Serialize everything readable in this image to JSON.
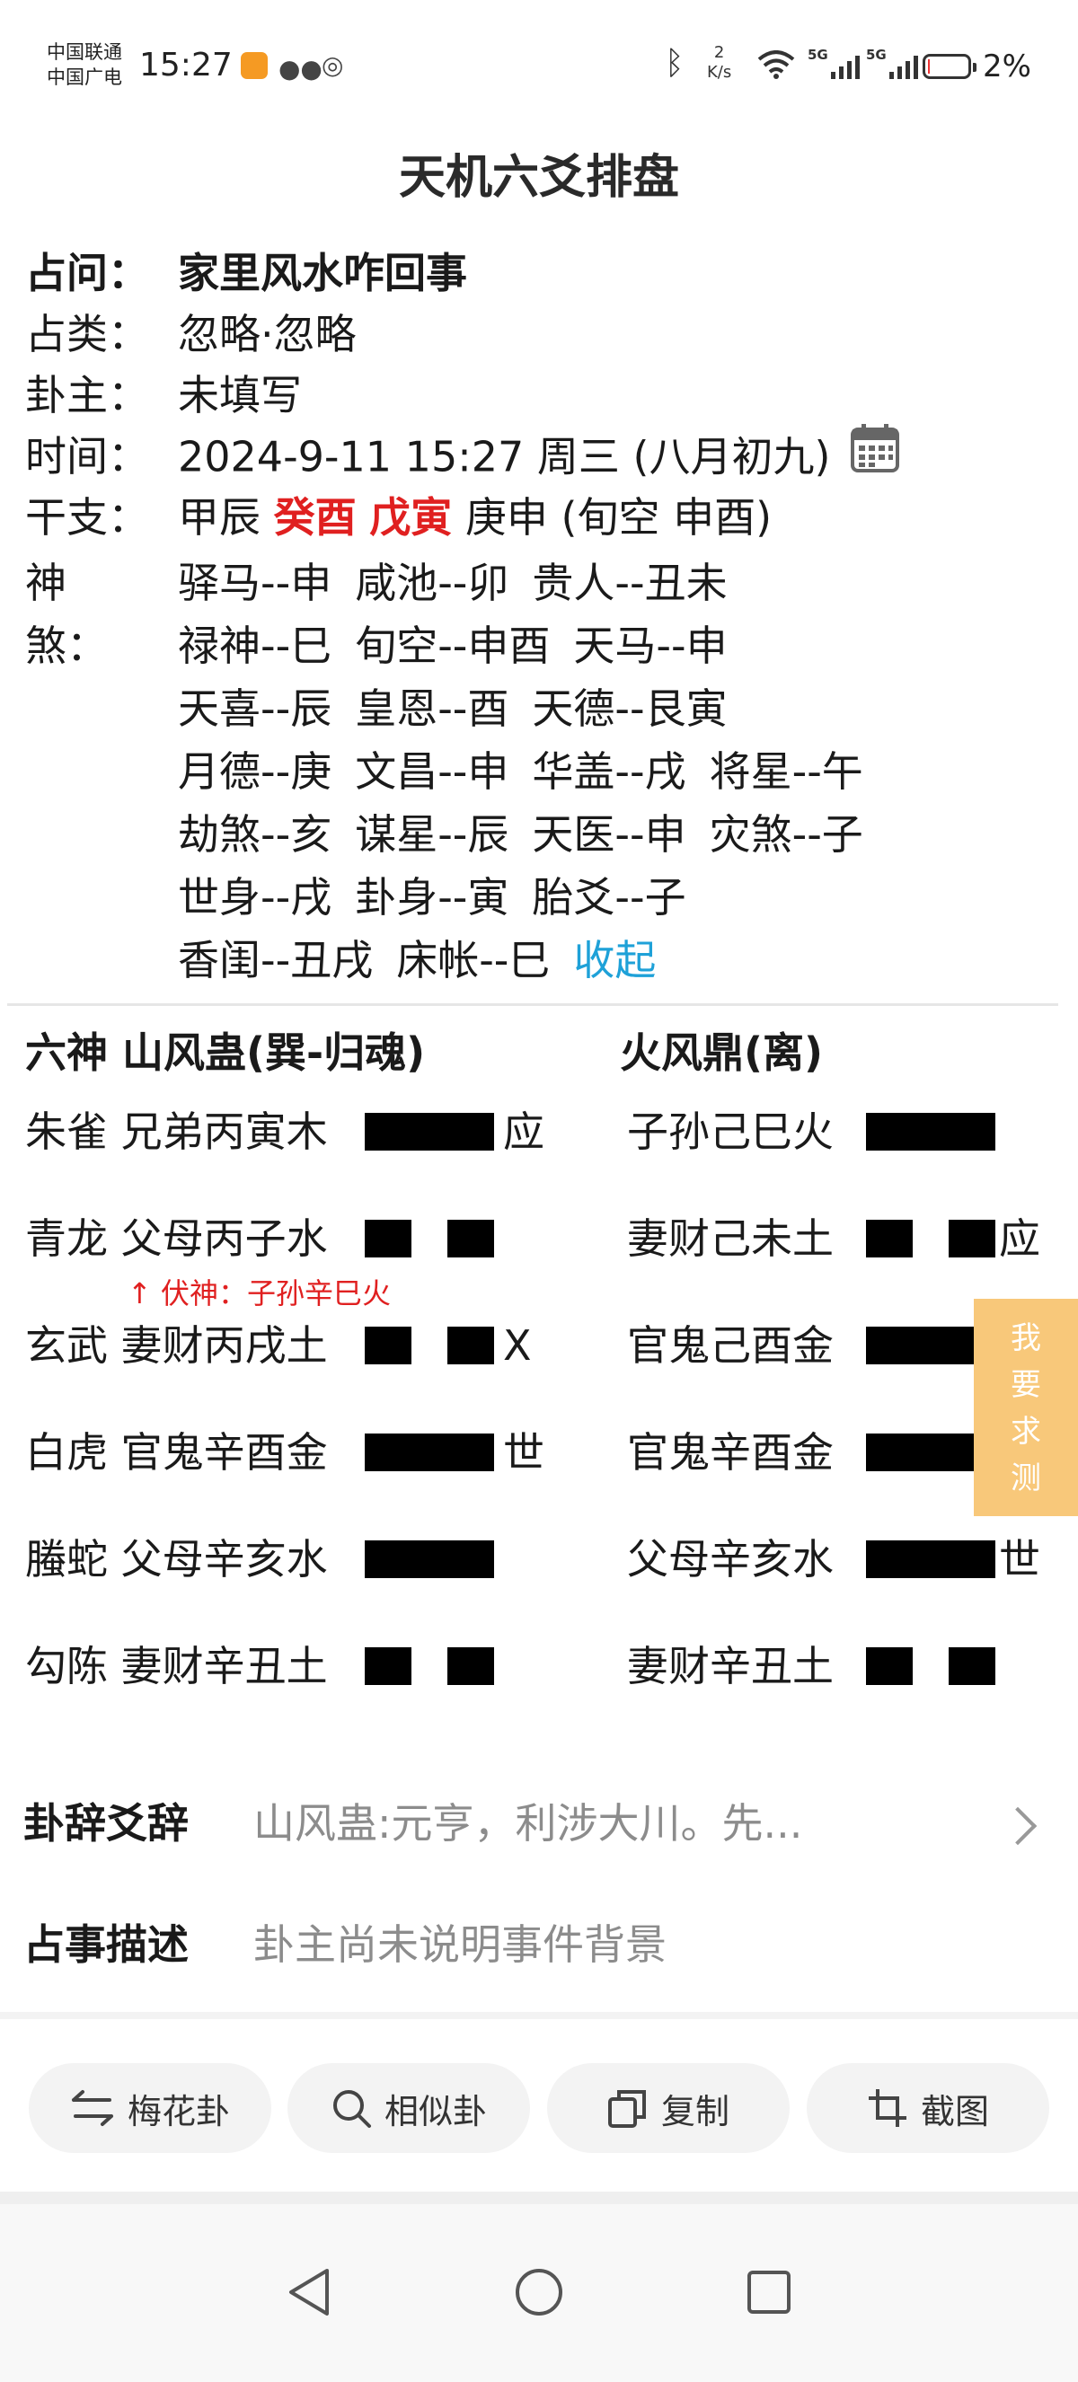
{
  "status_bar": {
    "carrier_1": "中国联通",
    "carrier_2": "中国广电",
    "time": "15:27",
    "net_speed_value": "2",
    "net_speed_unit": "K/s",
    "signal_1_tag": "5G",
    "signal_2_tag": "5G",
    "battery": "2%",
    "battery_level": 0.02,
    "icons": [
      "app-badge-icon",
      "wechat-icon",
      "location-icon",
      "bluetooth-icon",
      "wifi-icon",
      "signal-icon",
      "battery-icon"
    ]
  },
  "page_title": "天机六爻排盘",
  "info": {
    "question_label": "占问：",
    "question": "家里风水咋回事",
    "category_label": "占类：",
    "category": "忽略·忽略",
    "owner_label": "卦主：",
    "owner": "未填写",
    "time_label": "时间：",
    "time": "2024-9-11 15:27 周三 (八月初九)",
    "ganzhi_label": "干支：",
    "ganzhi": [
      "甲辰",
      "癸酉",
      "戊寅",
      "庚申"
    ],
    "xunkong": "(旬空 申酉)",
    "shensha_label": "神煞：",
    "shensha_lines": [
      [
        "驿马--申",
        "咸池--卯",
        "贵人--丑未"
      ],
      [
        "禄神--巳",
        "旬空--申酉",
        "天马--申"
      ],
      [
        "天喜--辰",
        "皇恩--酉",
        "天德--艮寅"
      ],
      [
        "月德--庚",
        "文昌--申",
        "华盖--戌",
        "将星--午"
      ],
      [
        "劫煞--亥",
        "谋星--辰",
        "天医--申",
        "灾煞--子"
      ],
      [
        "世身--戌",
        "卦身--寅",
        "胎爻--子"
      ],
      [
        "香闺--丑戌",
        "床帐--巳"
      ]
    ],
    "collapse_label": "收起"
  },
  "gua": {
    "left_header": "六神 山风蛊(巽-归魂)",
    "right_header": "火风鼎(离)",
    "left_yao": [
      {
        "text": "朱雀 兄弟丙寅木",
        "line": "yang",
        "mark": "应"
      },
      {
        "text": "青龙 父母丙子水",
        "line": "yin",
        "mark": ""
      },
      {
        "text": "玄武 妻财丙戌土",
        "line": "yin",
        "mark": "X"
      },
      {
        "text": "白虎 官鬼辛酉金",
        "line": "yang",
        "mark": "世"
      },
      {
        "text": "螣蛇 父母辛亥水",
        "line": "yang",
        "mark": ""
      },
      {
        "text": "勾陈 妻财辛丑土",
        "line": "yin",
        "mark": ""
      }
    ],
    "right_yao": [
      {
        "text": "子孙己巳火",
        "line": "yang",
        "mark": ""
      },
      {
        "text": "妻财己未土",
        "line": "yin",
        "mark": "应"
      },
      {
        "text": "官鬼己酉金",
        "line": "yang",
        "mark": ""
      },
      {
        "text": "官鬼辛酉金",
        "line": "yang",
        "mark": ""
      },
      {
        "text": "父母辛亥水",
        "line": "yang",
        "mark": "世"
      },
      {
        "text": "妻财辛丑土",
        "line": "yin",
        "mark": ""
      }
    ],
    "fushen": "↑ 伏神：子孙辛巳火"
  },
  "ask_button": [
    "我",
    "要",
    "求",
    "测"
  ],
  "desc": {
    "gua_ci_label": "卦辞爻辞",
    "gua_ci_value": "山风蛊:元亨，利涉大川。先...",
    "event_label": "占事描述",
    "event_value": "卦主尚未说明事件背景"
  },
  "buttons": {
    "meihua": "梅花卦",
    "similar": "相似卦",
    "copy": "复制",
    "screenshot": "截图"
  },
  "colors": {
    "accent_red": "#e02020",
    "link_blue": "#1ea1d8",
    "ask_orange": "#f8c87a"
  }
}
